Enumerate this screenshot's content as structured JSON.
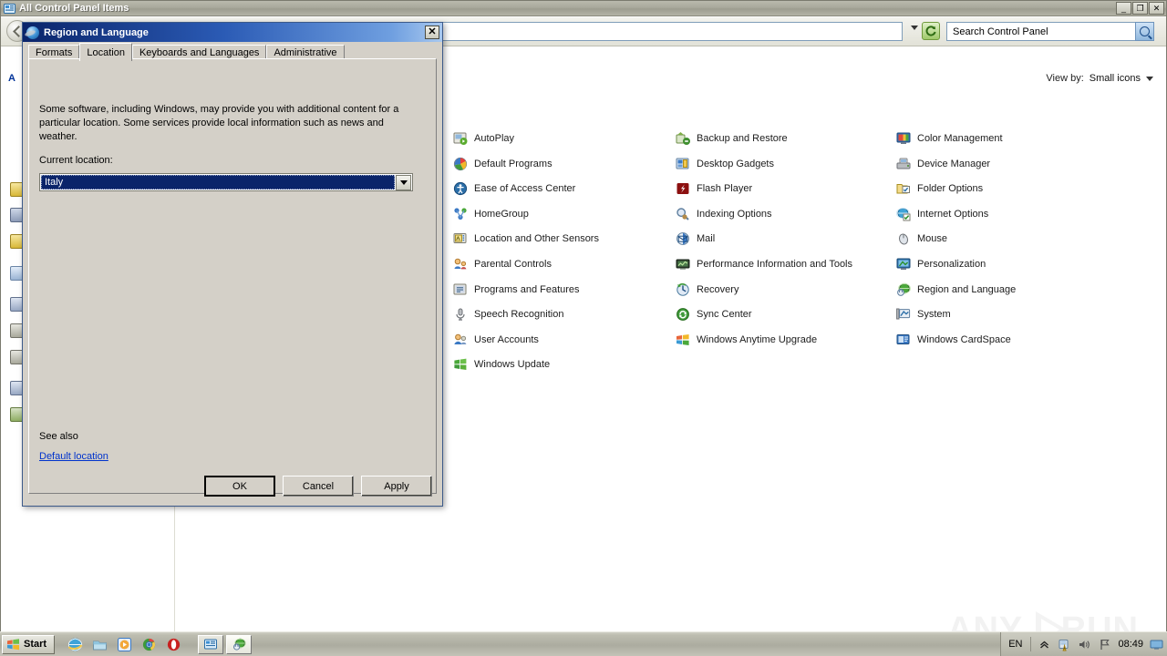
{
  "window": {
    "title": "All Control Panel Items",
    "title_icon": "control-panel-icon",
    "buttons": {
      "minimize": "_",
      "maximize": "❐",
      "close": "✕"
    },
    "address": {
      "value": "",
      "dropdown_icon": "chevron-down-icon",
      "refresh_icon": "refresh-icon"
    },
    "search": {
      "placeholder": "Search Control Panel",
      "value": "Search Control Panel",
      "icon": "search-icon"
    }
  },
  "left_pane": {
    "heading": "A",
    "items": []
  },
  "view_by": {
    "label": "View by:",
    "value": "Small icons",
    "caret_icon": "chevron-down-icon"
  },
  "items": [
    {
      "label": "AutoPlay",
      "icon": "autoplay-icon",
      "col": 1
    },
    {
      "label": "Backup and Restore",
      "icon": "backup-restore-icon",
      "col": 2
    },
    {
      "label": "Color Management",
      "icon": "color-management-icon",
      "col": 3
    },
    {
      "label": "Default Programs",
      "icon": "default-programs-icon",
      "col": 1
    },
    {
      "label": "Desktop Gadgets",
      "icon": "desktop-gadgets-icon",
      "col": 2
    },
    {
      "label": "Device Manager",
      "icon": "device-manager-icon",
      "col": 3
    },
    {
      "label": "Ease of Access Center",
      "icon": "ease-of-access-icon",
      "col": 1
    },
    {
      "label": "Flash Player",
      "icon": "flash-player-icon",
      "col": 2
    },
    {
      "label": "Folder Options",
      "icon": "folder-options-icon",
      "col": 3
    },
    {
      "label": "HomeGroup",
      "icon": "homegroup-icon",
      "col": 1
    },
    {
      "label": "Indexing Options",
      "icon": "indexing-options-icon",
      "col": 2
    },
    {
      "label": "Internet Options",
      "icon": "internet-options-icon",
      "col": 3
    },
    {
      "label": "Location and Other Sensors",
      "icon": "location-sensors-icon",
      "col": 1
    },
    {
      "label": "Mail",
      "icon": "mail-icon",
      "col": 2
    },
    {
      "label": "Mouse",
      "icon": "mouse-icon",
      "col": 3
    },
    {
      "label": "Parental Controls",
      "icon": "parental-controls-icon",
      "col": 1
    },
    {
      "label": "Performance Information and Tools",
      "icon": "performance-info-icon",
      "col": 2
    },
    {
      "label": "Personalization",
      "icon": "personalization-icon",
      "col": 3
    },
    {
      "label": "Programs and Features",
      "icon": "programs-features-icon",
      "col": 1
    },
    {
      "label": "Recovery",
      "icon": "recovery-icon",
      "col": 2
    },
    {
      "label": "Region and Language",
      "icon": "region-language-icon",
      "col": 3
    },
    {
      "label": "Speech Recognition",
      "icon": "speech-recognition-icon",
      "col": 1
    },
    {
      "label": "Sync Center",
      "icon": "sync-center-icon",
      "col": 2
    },
    {
      "label": "System",
      "icon": "system-icon",
      "col": 3
    },
    {
      "label": "User Accounts",
      "icon": "user-accounts-icon",
      "col": 1
    },
    {
      "label": "Windows Anytime Upgrade",
      "icon": "anytime-upgrade-icon",
      "col": 2
    },
    {
      "label": "Windows CardSpace",
      "icon": "cardspace-icon",
      "col": 3
    },
    {
      "label": "Windows Update",
      "icon": "windows-update-icon",
      "col": 1
    }
  ],
  "dialog": {
    "title": "Region and Language",
    "icon": "region-language-icon",
    "close_label": "✕",
    "tabs": [
      {
        "label": "Formats",
        "active": false
      },
      {
        "label": "Location",
        "active": true
      },
      {
        "label": "Keyboards and Languages",
        "active": false
      },
      {
        "label": "Administrative",
        "active": false
      }
    ],
    "intro_text": "Some software, including Windows, may provide you with additional content for a particular location. Some services provide local information such as news and weather.",
    "current_location_label": "Current location:",
    "current_location_value": "Italy",
    "combo_caret_icon": "chevron-down-icon",
    "see_also_label": "See also",
    "see_also_link": "Default location",
    "buttons": {
      "ok": "OK",
      "cancel": "Cancel",
      "apply": "Apply"
    }
  },
  "watermark": {
    "left": "ANY",
    "right": "RUN",
    "play_icon": "play-triangle-icon"
  },
  "taskbar": {
    "start_label": "Start",
    "start_icon": "windows-flag-icon",
    "quick_launch": [
      {
        "icon": "internet-explorer-icon"
      },
      {
        "icon": "windows-explorer-icon"
      },
      {
        "icon": "media-player-icon"
      },
      {
        "icon": "chrome-icon"
      },
      {
        "icon": "opera-icon"
      }
    ],
    "task_buttons": [
      {
        "icon": "control-panel-icon",
        "active": false
      },
      {
        "icon": "region-language-icon",
        "active": true
      }
    ],
    "tray": {
      "language": "EN",
      "show_hidden_icon": "chevron-up-icon",
      "action_center_icon": "action-center-warning-icon",
      "volume_icon": "speaker-icon",
      "network_icon": "network-flag-icon",
      "clock": "08:49",
      "show_desktop_icon": "show-desktop-icon"
    }
  },
  "colors": {
    "title_active": "#0a246a",
    "dialog_face": "#d4d0c8",
    "link": "#0033cc",
    "selection": "#0a246a"
  }
}
